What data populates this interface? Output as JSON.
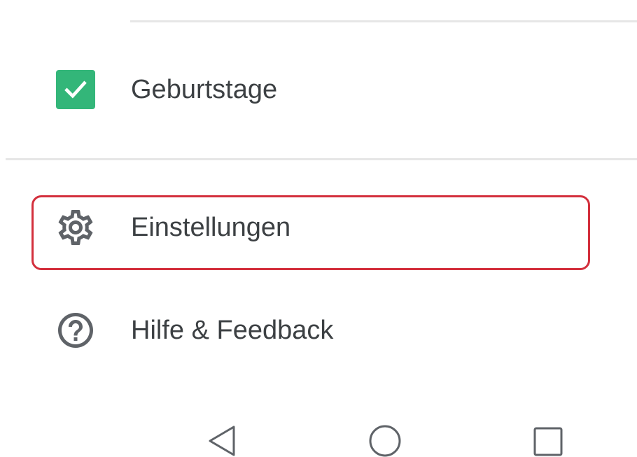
{
  "menu": {
    "items": [
      {
        "label": "Geburtstage",
        "icon": "checkbox-checked-icon",
        "checked": true,
        "color": "#33b679"
      },
      {
        "label": "Einstellungen",
        "icon": "gear-icon",
        "highlighted": true
      },
      {
        "label": "Hilfe & Feedback",
        "icon": "help-circle-icon"
      }
    ]
  },
  "navbar": {
    "buttons": [
      {
        "icon": "back-triangle-icon"
      },
      {
        "icon": "home-circle-icon"
      },
      {
        "icon": "recents-square-icon"
      }
    ]
  },
  "colors": {
    "checkbox": "#33b679",
    "highlight": "#d32f3c",
    "text": "#3c4043",
    "icon": "#5f6368",
    "divider": "#e6e6e6"
  }
}
